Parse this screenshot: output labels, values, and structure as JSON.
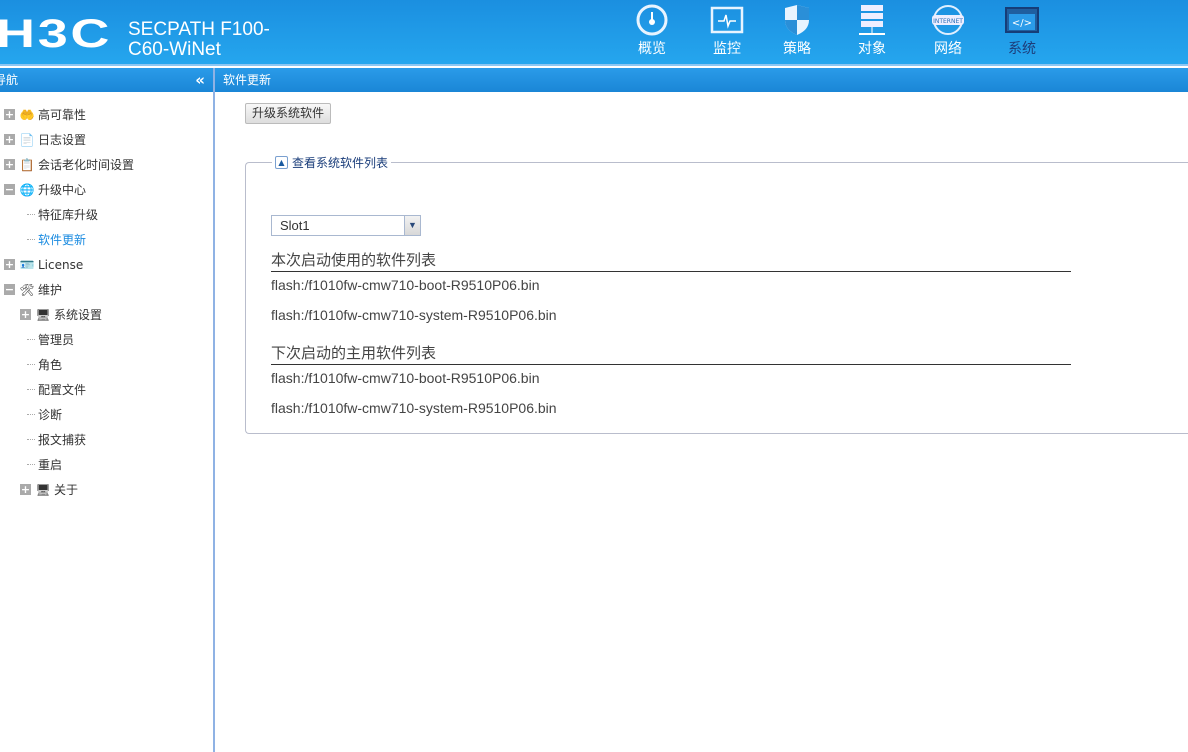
{
  "header": {
    "logo": "H3C",
    "product": "SECPATH F100-C60-WiNet",
    "product_line1": "SECPATH F100-",
    "product_line2": "C60-WiNet",
    "nav": [
      {
        "label": "概览",
        "icon": "gauge-icon"
      },
      {
        "label": "监控",
        "icon": "monitor-icon"
      },
      {
        "label": "策略",
        "icon": "shield-icon"
      },
      {
        "label": "对象",
        "icon": "server-icon"
      },
      {
        "label": "网络",
        "icon": "internet-globe-icon"
      },
      {
        "label": "系统",
        "icon": "code-window-icon",
        "active": true
      }
    ]
  },
  "sidebar": {
    "title": "导航",
    "collapse": "«",
    "items": [
      {
        "label": "高可靠性"
      },
      {
        "label": "日志设置"
      },
      {
        "label": "会话老化时间设置"
      },
      {
        "label": "升级中心"
      },
      {
        "label": "特征库升级"
      },
      {
        "label": "软件更新"
      },
      {
        "label": "License"
      },
      {
        "label": "维护"
      },
      {
        "label": "系统设置"
      },
      {
        "label": "管理员"
      },
      {
        "label": "角色"
      },
      {
        "label": "配置文件"
      },
      {
        "label": "诊断"
      },
      {
        "label": "报文捕获"
      },
      {
        "label": "重启"
      },
      {
        "label": "关于"
      }
    ]
  },
  "main": {
    "title": "软件更新",
    "upgrade_button": "升级系统软件",
    "fieldset_legend": "查看系统软件列表",
    "slot_select": "Slot1",
    "current_title": "本次启动使用的软件列表",
    "current_files": [
      "flash:/f1010fw-cmw710-boot-R9510P06.bin",
      "flash:/f1010fw-cmw710-system-R9510P06.bin"
    ],
    "next_title": "下次启动的主用软件列表",
    "next_files": [
      "flash:/f1010fw-cmw710-boot-R9510P06.bin",
      "flash:/f1010fw-cmw710-system-R9510P06.bin"
    ]
  }
}
